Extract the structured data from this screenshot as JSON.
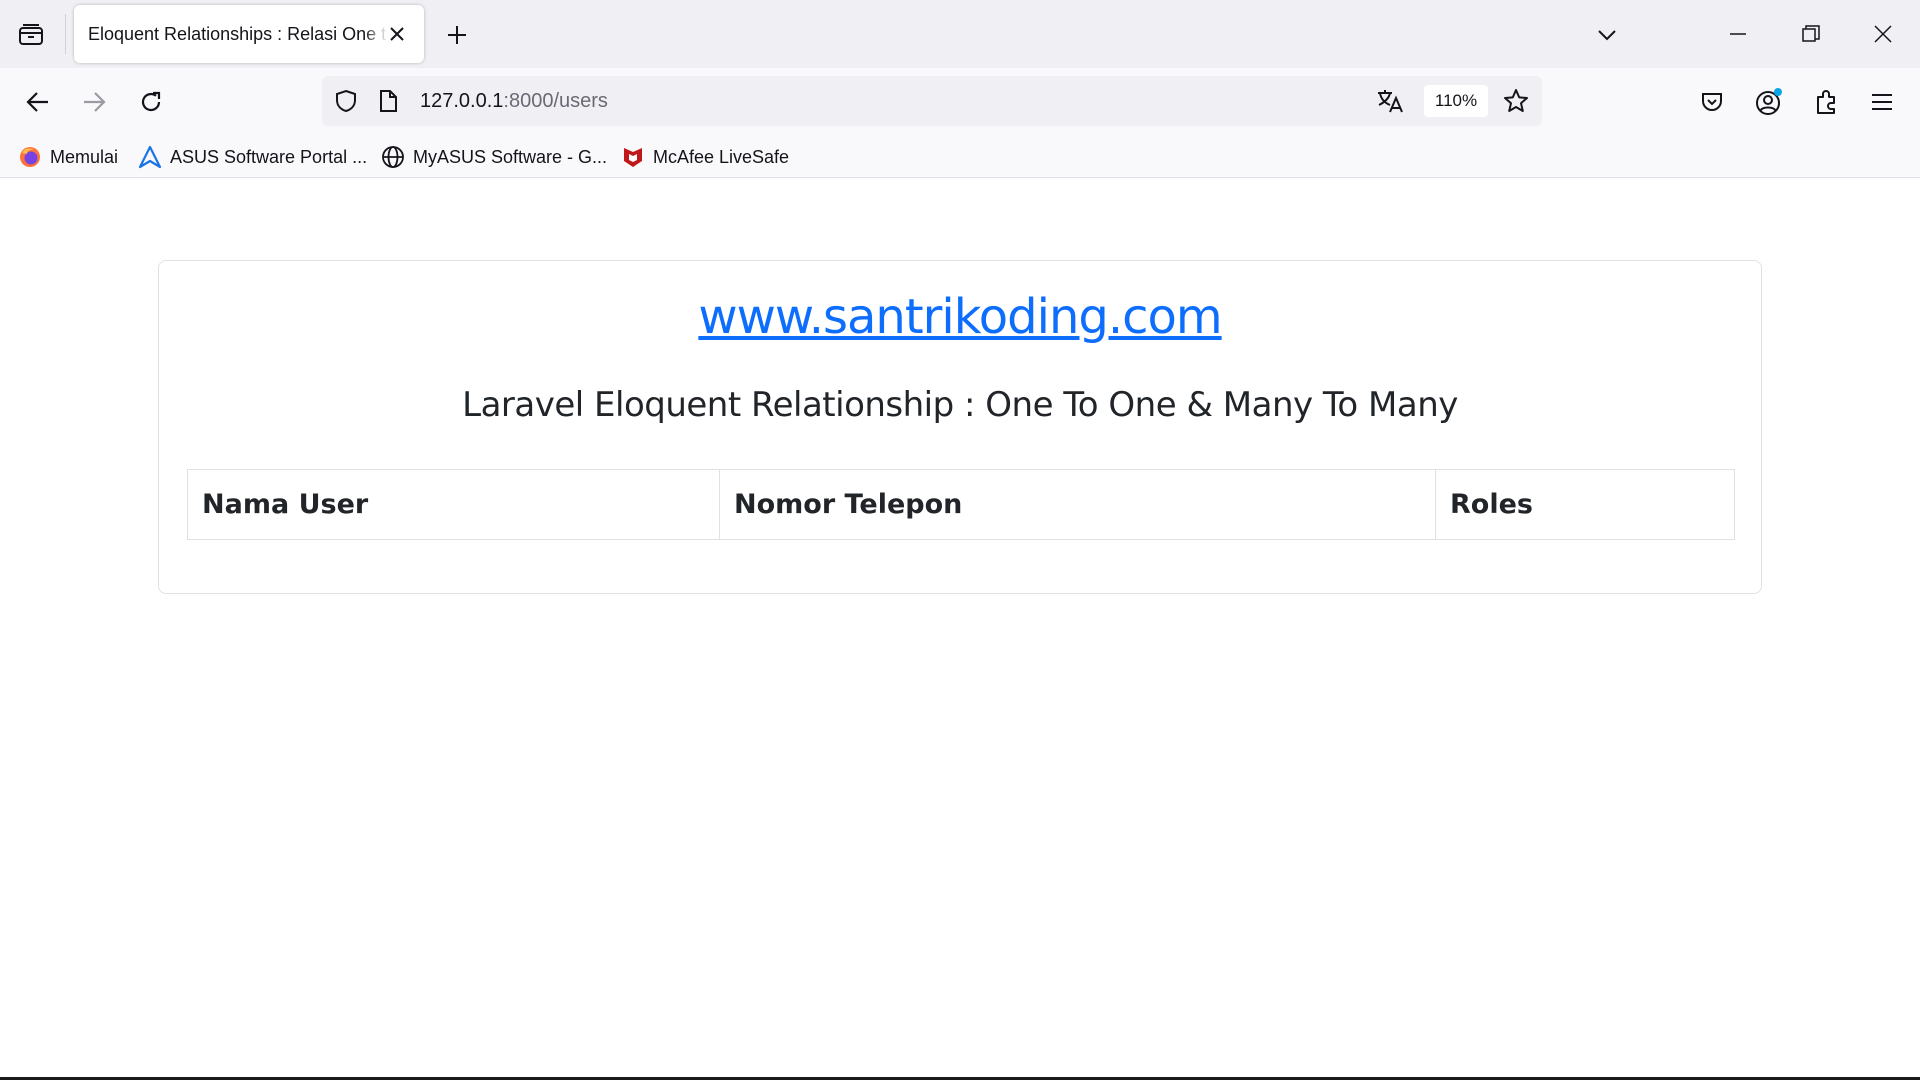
{
  "browser": {
    "tab": {
      "title": "Eloquent Relationships : Relasi One to One & Many to Many"
    },
    "url": {
      "host": "127.0.0.1",
      "path": ":8000/users"
    },
    "zoom": "110%",
    "bookmarks": [
      {
        "label": "Memulai",
        "icon": "firefox-icon"
      },
      {
        "label": "ASUS Software Portal ...",
        "icon": "asus-icon"
      },
      {
        "label": "MyASUS Software - G...",
        "icon": "globe-icon"
      },
      {
        "label": "McAfee LiveSafe",
        "icon": "mcafee-icon"
      }
    ]
  },
  "page": {
    "link_text": "www.santrikoding.com",
    "subtitle": "Laravel Eloquent Relationship : One To One & Many To Many",
    "table": {
      "headers": [
        "Nama User",
        "Nomor Telepon",
        "Roles"
      ],
      "rows": []
    }
  },
  "colors": {
    "link": "#0d6efd",
    "text": "#212529",
    "border": "#dee2e6"
  }
}
